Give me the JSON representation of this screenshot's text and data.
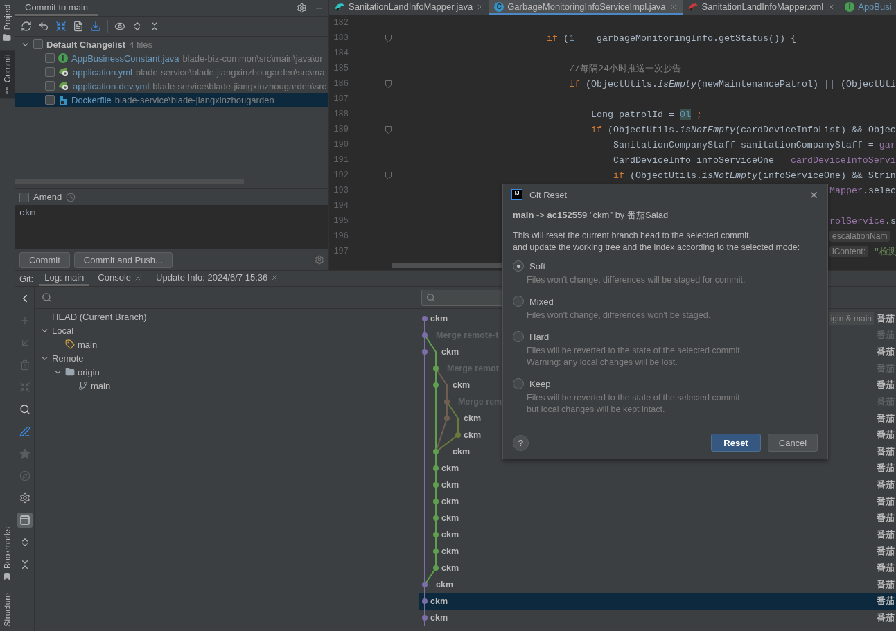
{
  "tool_stripe": {
    "top": [
      {
        "label": "Project",
        "kind": "folder",
        "selected": false
      },
      {
        "label": "Commit",
        "kind": "commit",
        "selected": true
      }
    ],
    "bottom": [
      {
        "label": "Bookmarks",
        "kind": "bookmark"
      },
      {
        "label": "Structure",
        "kind": "none"
      }
    ]
  },
  "commit_panel": {
    "tab": "Commit to main",
    "changelist": {
      "name": "Default Changelist",
      "count": "4 files",
      "expanded": true,
      "checked": false
    },
    "files": [
      {
        "name": "AppBusinessConstant.java",
        "path": "blade-biz-common\\src\\main\\java\\or",
        "kind": "interface",
        "badge": "I",
        "checked": false,
        "selected": false
      },
      {
        "name": "application.yml",
        "path": "blade-service\\blade-jiangxinzhougarden\\src\\ma",
        "kind": "spring",
        "checked": false,
        "selected": false
      },
      {
        "name": "application-dev.yml",
        "path": "blade-service\\blade-jiangxinzhougarden\\src",
        "kind": "spring",
        "checked": false,
        "selected": false
      },
      {
        "name": "Dockerfile",
        "path": "blade-service\\blade-jiangxinzhougarden",
        "kind": "docker",
        "checked": false,
        "selected": true
      }
    ],
    "amend": {
      "label": "Amend",
      "checked": false
    },
    "message": "ckm",
    "buttons": [
      "Commit",
      "Commit and Push..."
    ]
  },
  "editor": {
    "tabs": [
      {
        "title": "SanitationLandInfoMapper.java",
        "kind": "mapper-java",
        "selected": false
      },
      {
        "title": "GarbageMonitoringInfoServiceImpl.java",
        "kind": "class",
        "badge": "C",
        "selected": true
      },
      {
        "title": "SanitationLandInfoMapper.xml",
        "kind": "mapper-xml",
        "selected": false
      },
      {
        "title": "AppBusi",
        "kind": "interface",
        "badge": "I",
        "selected": false
      }
    ],
    "lines": [
      {
        "number": "182",
        "kind": "code",
        "fold": false
      },
      {
        "number": "183",
        "kind": "code",
        "fold": true,
        "tokens": [
          {
            "t": "                        if",
            "kind": "keyword"
          },
          {
            "t": " ("
          },
          {
            "t": "1",
            "kind": "number"
          },
          {
            "t": " == garbageMonitoringInfo.getStatus()) {"
          }
        ]
      },
      {
        "number": "184",
        "kind": "code",
        "fold": false
      },
      {
        "number": "185",
        "kind": "code",
        "fold": false,
        "tokens": [
          {
            "t": "                            //每隔24小时推送一次抄告",
            "kind": "comment"
          }
        ]
      },
      {
        "number": "186",
        "kind": "code",
        "fold": true,
        "tokens": [
          {
            "t": "                            if",
            "kind": "keyword"
          },
          {
            "t": " (ObjectUtils."
          },
          {
            "t": "isEmpty",
            "kind": "call"
          },
          {
            "t": "(newMaintenancePatrol) || (ObjectUti"
          }
        ]
      },
      {
        "number": "187",
        "kind": "code",
        "fold": false
      },
      {
        "number": "188",
        "kind": "code",
        "fold": false,
        "tokens": [
          {
            "t": "                                Long "
          },
          {
            "t": "patrolId",
            "kind": "variable"
          },
          {
            "t": " = "
          },
          {
            "t": "0l",
            "kind": "highlight"
          },
          {
            "t": " ;",
            "kind": "keyword"
          }
        ]
      },
      {
        "number": "189",
        "kind": "code",
        "fold": true,
        "tokens": [
          {
            "t": "                                if",
            "kind": "keyword"
          },
          {
            "t": " (ObjectUtils."
          },
          {
            "t": "isNotEmpty",
            "kind": "call"
          },
          {
            "t": "(cardDeviceInfoList) && Objec"
          }
        ]
      },
      {
        "number": "190",
        "kind": "code",
        "fold": false,
        "tokens": [
          {
            "t": "                                    SanitationCompanyStaff sanitationCompanyStaff = "
          },
          {
            "t": "gar",
            "kind": "field"
          }
        ]
      },
      {
        "number": "191",
        "kind": "code",
        "fold": false,
        "tokens": [
          {
            "t": "                                    CardDeviceInfo infoServiceOne = "
          },
          {
            "t": "cardDeviceInfoServi",
            "kind": "field"
          }
        ]
      },
      {
        "number": "192",
        "kind": "code",
        "fold": true,
        "tokens": [
          {
            "t": "                                    if",
            "kind": "keyword"
          },
          {
            "t": " (ObjectUtils."
          },
          {
            "t": "isNotEmpty",
            "kind": "call"
          },
          {
            "t": "(infoServiceOne) && Strin"
          }
        ]
      },
      {
        "number": "193",
        "kind": "covered",
        "fold": false,
        "tokens": [
          {
            "t": "Mapper",
            "kind": "field"
          },
          {
            "t": ".selec"
          }
        ]
      },
      {
        "number": "194",
        "kind": "code",
        "fold": false
      },
      {
        "number": "195",
        "kind": "covered",
        "fold": false,
        "tokens": [
          {
            "t": "rolService",
            "kind": "field"
          },
          {
            "t": ".s"
          }
        ]
      },
      {
        "number": "196",
        "kind": "covered",
        "fold": false,
        "tokens": [
          {
            "t": "escalationNam",
            "kind": "hint"
          }
        ]
      },
      {
        "number": "197",
        "kind": "covered",
        "fold": false,
        "tokens": [
          {
            "t": "lContent:",
            "kind": "hint"
          },
          {
            "t": " \"检测",
            "kind": "string"
          }
        ]
      }
    ]
  },
  "git": {
    "label": "Git:",
    "tabs": [
      {
        "label": "Log: main",
        "selected": true,
        "closable": false
      },
      {
        "label": "Console",
        "selected": false,
        "closable": true
      },
      {
        "label": "Update Info: 2024/6/7 15:36",
        "selected": false,
        "closable": true
      }
    ],
    "branches": [
      {
        "label": "HEAD (Current Branch)"
      },
      {
        "label": "Local",
        "expanded": true,
        "children": [
          {
            "label": "main",
            "kind": "local"
          }
        ]
      },
      {
        "label": "Remote",
        "expanded": true,
        "children": [
          {
            "label": "origin",
            "kind": "folder",
            "expanded": true,
            "children": [
              {
                "label": "main",
                "kind": "remote"
              }
            ]
          }
        ]
      }
    ],
    "commits": [
      {
        "message": "ckm",
        "author": "番茄",
        "merge": false,
        "selected": false,
        "refs": "igin & main"
      },
      {
        "message": "Merge remote-t",
        "author": "番茄",
        "merge": true,
        "selected": false
      },
      {
        "message": "ckm",
        "author": "番茄",
        "merge": false,
        "selected": false
      },
      {
        "message": "Merge remot",
        "author": "番茄",
        "merge": true,
        "selected": false
      },
      {
        "message": "ckm",
        "author": "番茄",
        "merge": false,
        "selected": false
      },
      {
        "message": "Merge rem",
        "author": "番茄",
        "merge": true,
        "selected": false
      },
      {
        "message": "ckm",
        "author": "番茄",
        "merge": false,
        "selected": false
      },
      {
        "message": "ckm",
        "author": "番茄",
        "merge": false,
        "selected": false
      },
      {
        "message": "ckm",
        "author": "番茄",
        "merge": false,
        "selected": false
      },
      {
        "message": "ckm",
        "author": "番茄",
        "merge": false,
        "selected": false
      },
      {
        "message": "ckm",
        "author": "番茄",
        "merge": false,
        "selected": false
      },
      {
        "message": "ckm",
        "author": "番茄",
        "merge": false,
        "selected": false
      },
      {
        "message": "ckm",
        "author": "番茄",
        "merge": false,
        "selected": false
      },
      {
        "message": "ckm",
        "author": "番茄",
        "merge": false,
        "selected": false
      },
      {
        "message": "ckm",
        "author": "番茄",
        "merge": false,
        "selected": false
      },
      {
        "message": "ckm",
        "author": "番茄",
        "merge": false,
        "selected": false
      },
      {
        "message": "ckm",
        "author": "番茄",
        "merge": false,
        "selected": false
      },
      {
        "message": "ckm",
        "author": "番茄",
        "merge": false,
        "selected": true
      },
      {
        "message": "ckm",
        "author": "番茄",
        "merge": false,
        "selected": false
      }
    ]
  },
  "dialog": {
    "app_icon": "IJ",
    "title": "Git Reset",
    "target": "**main** -> **ac152559** \"ckm\" by 番茄Salad",
    "description": [
      "This will reset the current branch head to the selected commit,",
      "and update the working tree and the index according to the selected mode:"
    ],
    "modes": [
      {
        "label": "Soft",
        "selected": true,
        "description": [
          "Files won't change, differences will be staged for commit."
        ]
      },
      {
        "label": "Mixed",
        "selected": false,
        "description": [
          "Files won't change, differences won't be staged."
        ]
      },
      {
        "label": "Hard",
        "selected": false,
        "description": [
          "Files will be reverted to the state of the selected commit.",
          "Warning: any local changes will be lost."
        ]
      },
      {
        "label": "Keep",
        "selected": false,
        "description": [
          "Files will be reverted to the state of the selected commit,",
          "but local changes will be kept intact."
        ]
      }
    ],
    "help": "?",
    "buttons": [
      {
        "label": "Reset",
        "default": true
      },
      {
        "label": "Cancel",
        "default": false
      }
    ]
  }
}
